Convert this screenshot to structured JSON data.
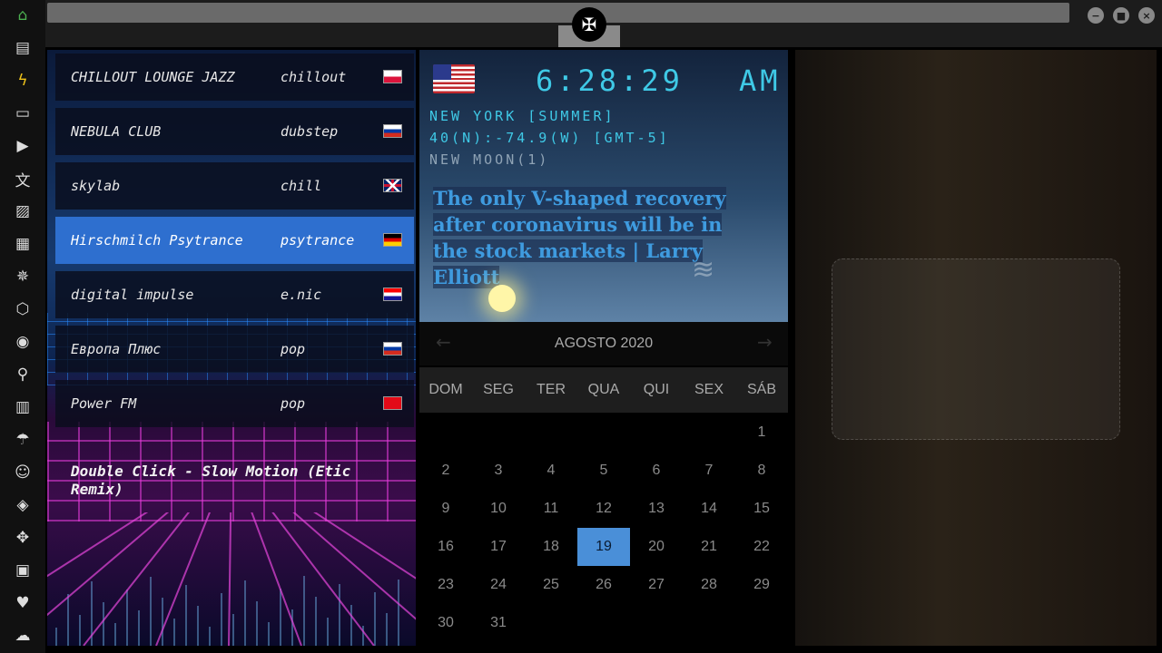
{
  "sidebar": {
    "icons": [
      {
        "name": "home-icon",
        "glyph": "⌂"
      },
      {
        "name": "document-icon",
        "glyph": "▤"
      },
      {
        "name": "lightning-icon",
        "glyph": "ϟ"
      },
      {
        "name": "archive-icon",
        "glyph": "▭"
      },
      {
        "name": "play-icon",
        "glyph": "▶"
      },
      {
        "name": "translate-icon",
        "glyph": "文"
      },
      {
        "name": "image-icon",
        "glyph": "▨"
      },
      {
        "name": "news-icon",
        "glyph": "▦"
      },
      {
        "name": "settings-icon",
        "glyph": "✵"
      },
      {
        "name": "network-icon",
        "glyph": "⬡"
      },
      {
        "name": "globe-icon",
        "glyph": "◉"
      },
      {
        "name": "search-icon",
        "glyph": "⚲"
      },
      {
        "name": "map-icon",
        "glyph": "▥"
      },
      {
        "name": "umbrella-icon",
        "glyph": "☂"
      },
      {
        "name": "contact-icon",
        "glyph": "☺"
      },
      {
        "name": "code-icon",
        "glyph": "◈"
      },
      {
        "name": "expand-icon",
        "glyph": "✥"
      },
      {
        "name": "youtube-icon",
        "glyph": "▣"
      },
      {
        "name": "heart-icon",
        "glyph": "♥"
      },
      {
        "name": "cloud-icon",
        "glyph": "☁"
      }
    ]
  },
  "window": {
    "emblem_glyph": "✠",
    "minimize_glyph": "−",
    "maximize_glyph": "■",
    "close_glyph": "×"
  },
  "radio": {
    "stations": [
      {
        "name": "CHILLOUT LOUNGE JAZZ",
        "genre": "chillout",
        "flag": "poland"
      },
      {
        "name": "NEBULA CLUB",
        "genre": "dubstep",
        "flag": "russia"
      },
      {
        "name": "skylab",
        "genre": "chill",
        "flag": "uk"
      },
      {
        "name": "Hirschmilch Psytrance",
        "genre": "psytrance",
        "flag": "germany"
      },
      {
        "name": "digital impulse",
        "genre": "e.nic",
        "flag": "croatia"
      },
      {
        "name": "Европа Плюс",
        "genre": "pop",
        "flag": "russia"
      },
      {
        "name": "Power FM",
        "genre": "pop",
        "flag": "turkey"
      }
    ],
    "selected_index": 3,
    "now_playing": "Double Click - Slow Motion (Etic Remix)"
  },
  "clock": {
    "time": "6:28:29",
    "ampm": "AM",
    "city": "NEW YORK [SUMMER]",
    "coords": "40(N):-74.9(W) [GMT-5]",
    "moon": "NEW MOON(1)",
    "headline": "The only V-shaped recovery after coronavirus will be in the stock markets | Larry Elliott"
  },
  "calendar": {
    "month_label": "AGOSTO 2020",
    "prev_glyph": "←",
    "next_glyph": "→",
    "weekdays": [
      "DOM",
      "SEG",
      "TER",
      "QUA",
      "QUI",
      "SEX",
      "SÁB"
    ],
    "weeks": [
      [
        "",
        "",
        "",
        "",
        "",
        "",
        "1"
      ],
      [
        "2",
        "3",
        "4",
        "5",
        "6",
        "7",
        "8"
      ],
      [
        "9",
        "10",
        "11",
        "12",
        "13",
        "14",
        "15"
      ],
      [
        "16",
        "17",
        "18",
        "19",
        "20",
        "21",
        "22"
      ],
      [
        "23",
        "24",
        "25",
        "26",
        "27",
        "28",
        "29"
      ],
      [
        "30",
        "31",
        "",
        "",
        "",
        "",
        ""
      ]
    ],
    "today": "19"
  }
}
